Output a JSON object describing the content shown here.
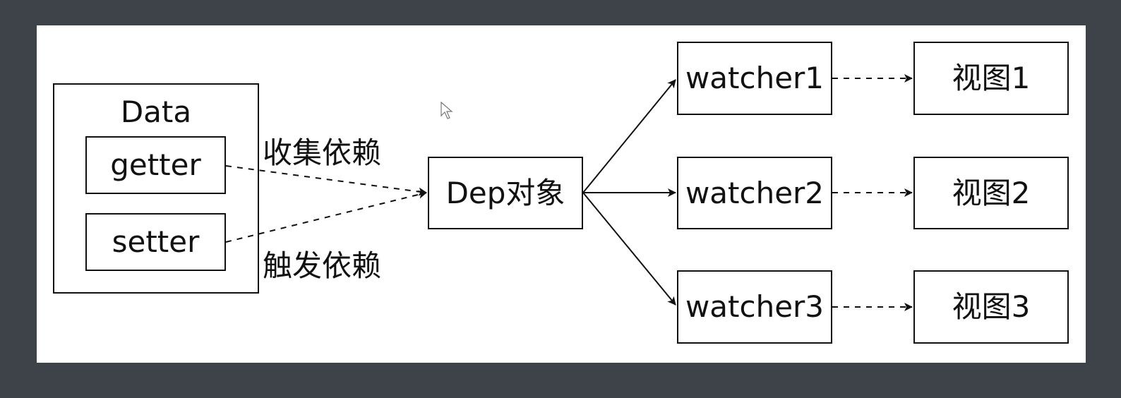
{
  "diagram": {
    "data_group": {
      "title": "Data",
      "getter": "getter",
      "setter": "setter"
    },
    "edge_labels": {
      "collect": "收集依赖",
      "trigger": "触发依赖"
    },
    "dep": "Dep对象",
    "watchers": [
      "watcher1",
      "watcher2",
      "watcher3"
    ],
    "views": [
      "视图1",
      "视图2",
      "视图3"
    ]
  },
  "colors": {
    "background": "#3e4249",
    "canvas": "#ffffff",
    "stroke": "#111111"
  }
}
